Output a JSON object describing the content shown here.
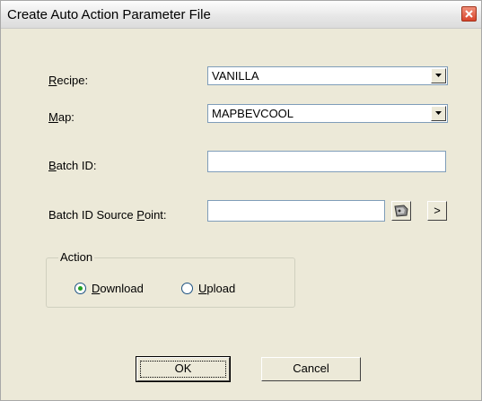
{
  "window": {
    "title": "Create Auto Action Parameter File"
  },
  "form": {
    "recipe": {
      "label_key": "R",
      "label_rest": "ecipe:",
      "value": "VANILLA"
    },
    "map": {
      "label_key": "M",
      "label_rest": "ap:",
      "value": "MAPBEVCOOL"
    },
    "batch_id": {
      "label_key": "B",
      "label_rest": "atch ID:",
      "value": ""
    },
    "batch_id_source": {
      "label_pre": "Batch ID Source ",
      "label_key": "P",
      "label_rest": "oint:",
      "value": "",
      "arrow_label": ">"
    }
  },
  "action_group": {
    "legend": "Action",
    "download": {
      "label_key": "D",
      "label_rest": "ownload",
      "checked": true
    },
    "upload": {
      "label_key": "U",
      "label_rest": "pload",
      "checked": false
    }
  },
  "buttons": {
    "ok": "OK",
    "cancel": "Cancel"
  },
  "icons": {
    "close": "close-icon",
    "dropdown": "chevron-down-icon",
    "browse": "tag-browse-icon"
  },
  "colors": {
    "close_red": "#d8442b",
    "radio_dot": "#21a121"
  }
}
